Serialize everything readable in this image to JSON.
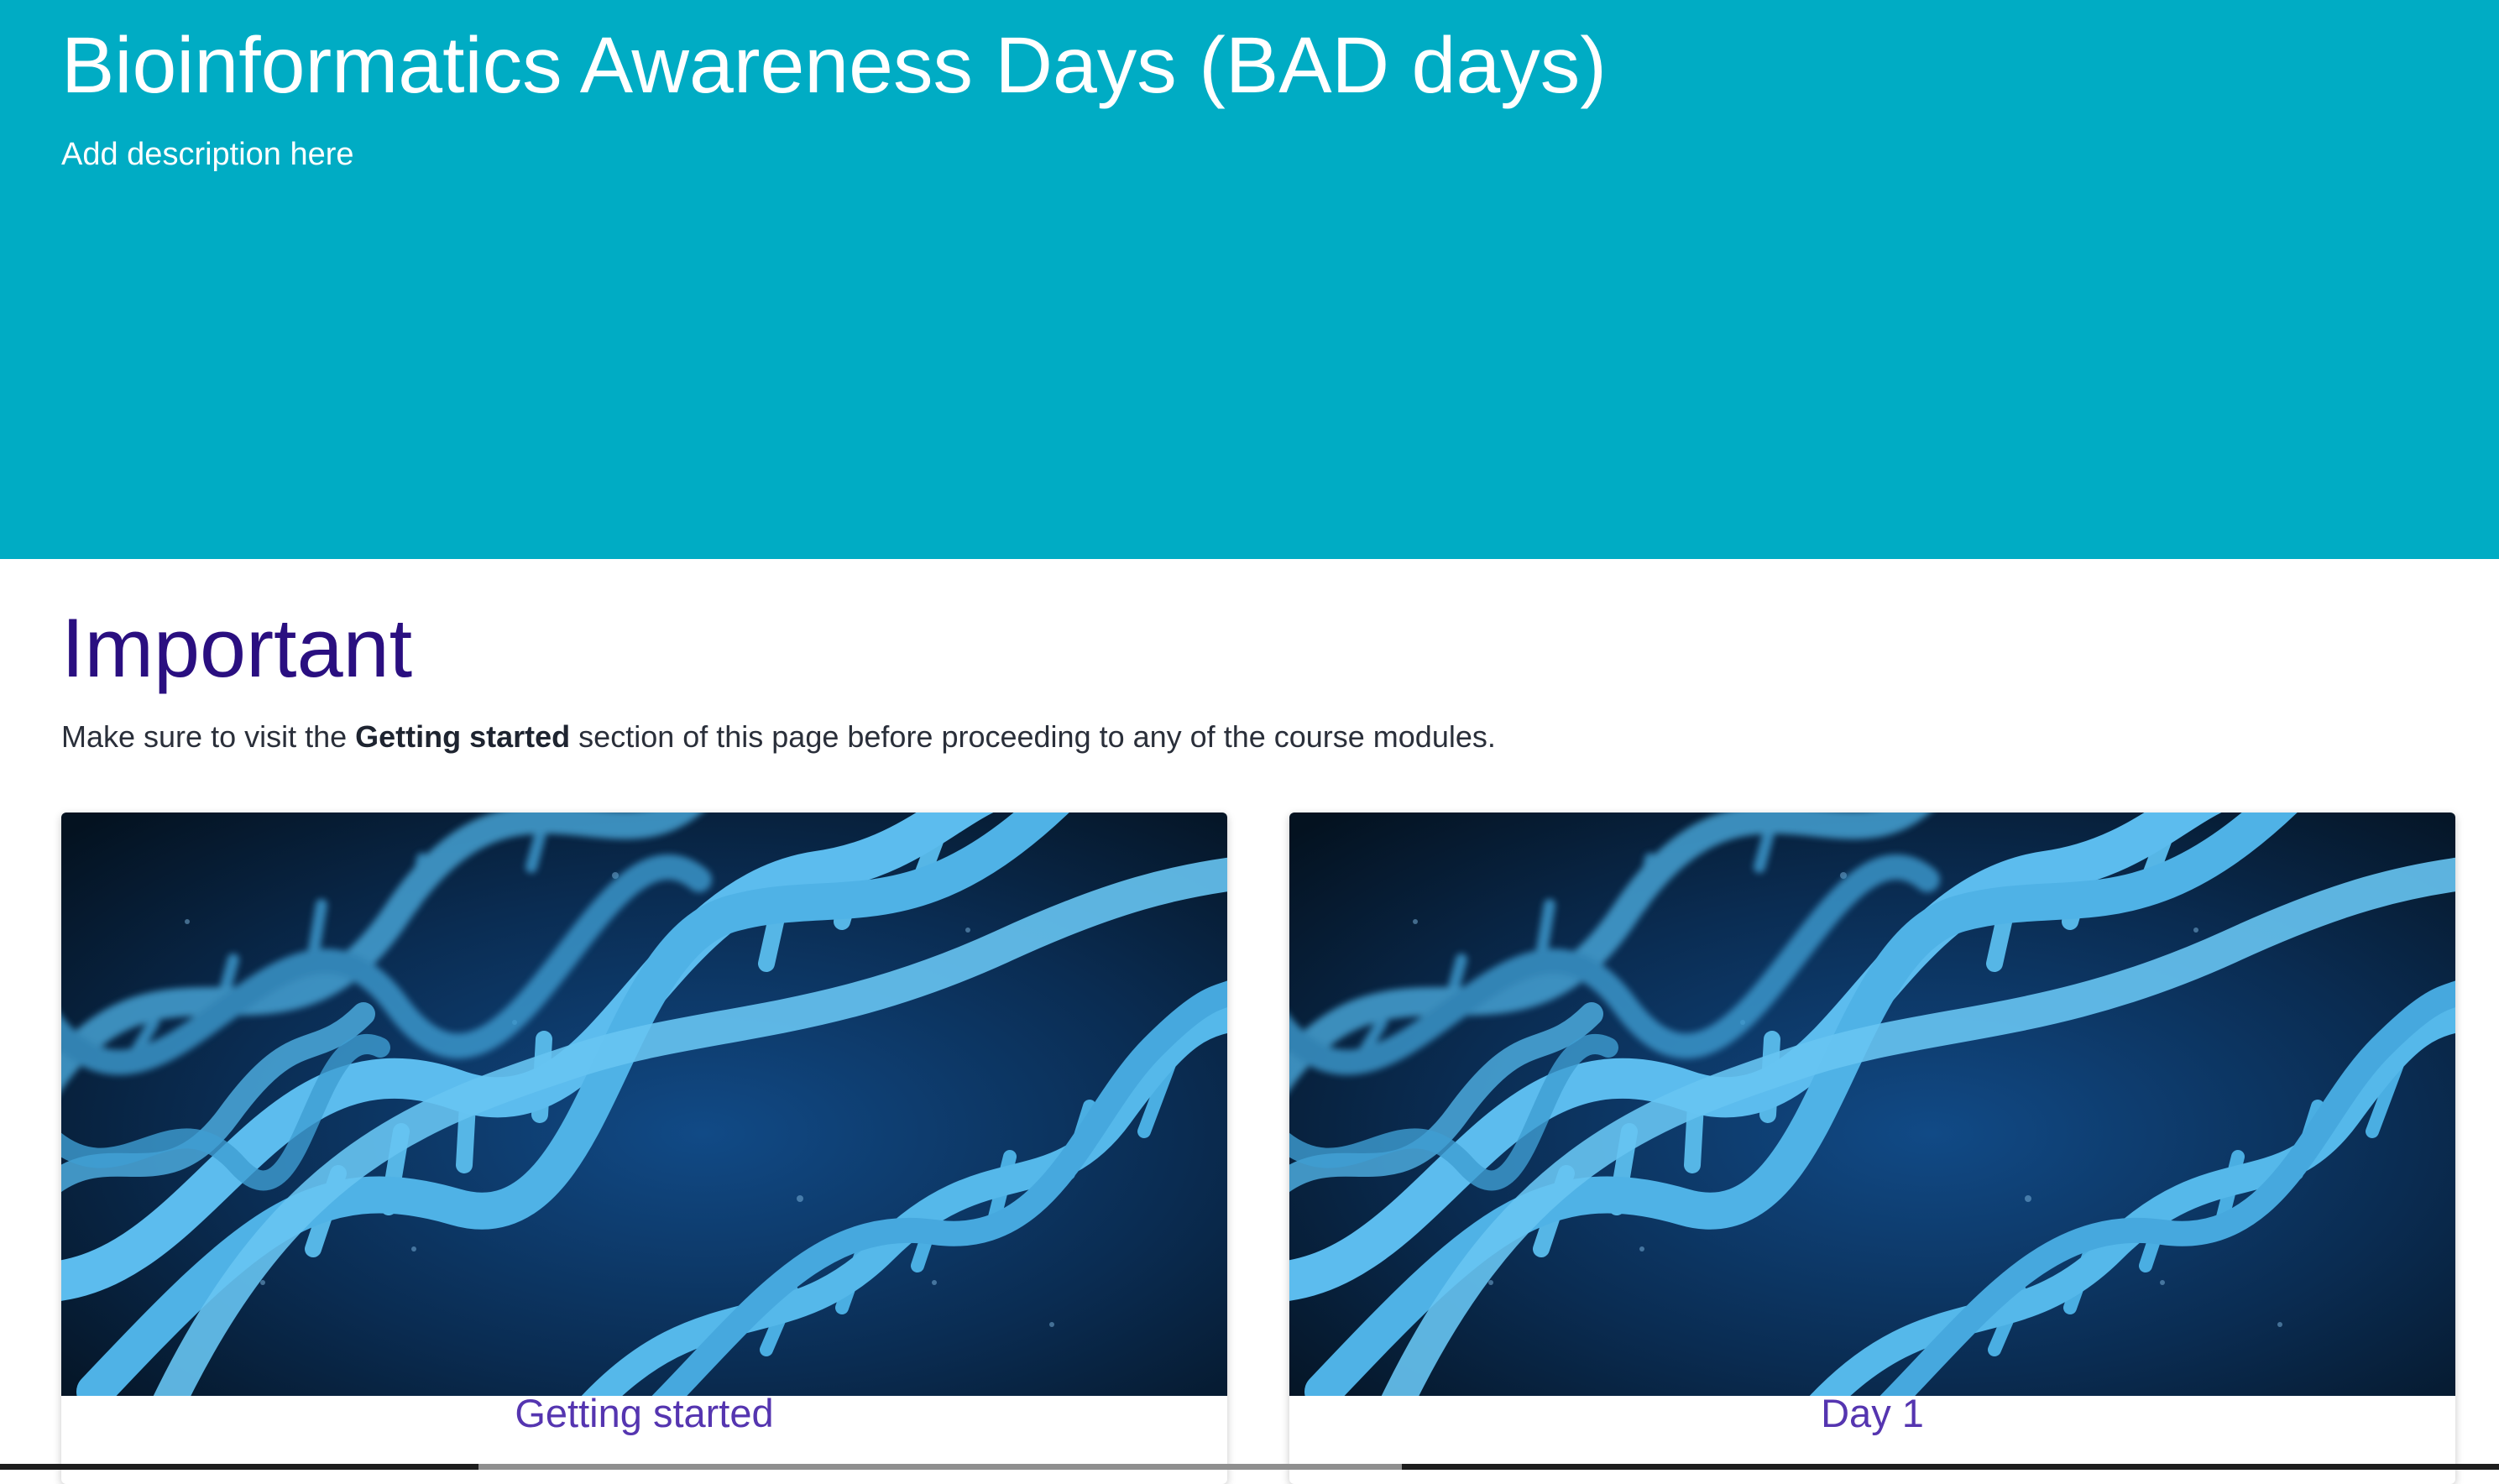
{
  "hero": {
    "title": "Bioinformatics Awareness Days (BAD days)",
    "description": "Add description here",
    "background_color": "#00acc4"
  },
  "important": {
    "heading": "Important",
    "notice_prefix": "Make sure to visit the ",
    "notice_bold": "Getting started",
    "notice_suffix": " section of this page before proceeding to any of the course modules."
  },
  "cards": [
    {
      "label": "Getting started",
      "image": "dna-double-helix-image"
    },
    {
      "label": "Day 1",
      "image": "dna-double-helix-image"
    }
  ],
  "colors": {
    "heading": "#2a0f80",
    "card_link": "#5535b0",
    "image_background": "#0a2a4a",
    "helix": "#4ab4e8"
  }
}
